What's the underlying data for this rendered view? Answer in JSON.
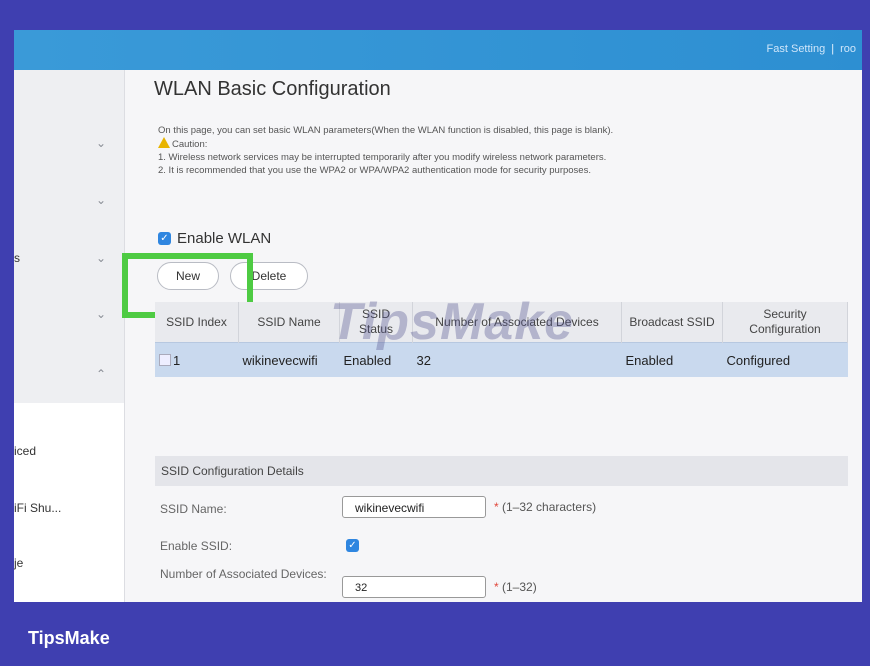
{
  "topbar": {
    "fast_setting": "Fast Setting",
    "separator": "|",
    "user": "roo"
  },
  "sidebar": {
    "items": [
      {
        "label": "",
        "chevron": "⌄"
      },
      {
        "label": "",
        "chevron": "⌄"
      },
      {
        "label": "s",
        "chevron": "⌄"
      },
      {
        "label": "",
        "chevron": "⌄"
      },
      {
        "label": "",
        "chevron": "⌃"
      }
    ],
    "lower_items": [
      "iced",
      "iFi Shu...",
      "je"
    ]
  },
  "page": {
    "title": "WLAN Basic Configuration",
    "intro": "On this page, you can set basic WLAN parameters(When the WLAN function is disabled, this page is blank).",
    "caution": "Caution:",
    "note1": "1. Wireless network services may be interrupted temporarily after you modify wireless network parameters.",
    "note2": "2. It is recommended that you use the WPA2 or WPA/WPA2 authentication mode for security purposes.",
    "enable_wlan": "Enable WLAN",
    "new_button": "New",
    "delete_button": "Delete"
  },
  "table": {
    "headers": [
      "SSID Index",
      "SSID Name",
      "SSID Status",
      "Number of Associated Devices",
      "Broadcast SSID",
      "Security Configuration"
    ],
    "rows": [
      [
        "1",
        "wikinevecwifi",
        "Enabled",
        "32",
        "Enabled",
        "Configured"
      ]
    ]
  },
  "ssid_config": {
    "section_title": "SSID Configuration Details",
    "ssid_name_label": "SSID Name:",
    "ssid_name_value": "wikinevecwifi",
    "ssid_name_hint": "(1–32 characters)",
    "enable_ssid_label": "Enable SSID:",
    "assoc_label": "Number of Associated Devices:",
    "assoc_value": "32",
    "assoc_hint": "(1–32)",
    "required_mark": "*"
  },
  "watermark": "TipsMake",
  "footer": {
    "brand": "TipsMake"
  },
  "colors": {
    "accent": "#2d8fd2",
    "highlight": "#4ecb43",
    "frame_border": "#3f3fb0"
  }
}
